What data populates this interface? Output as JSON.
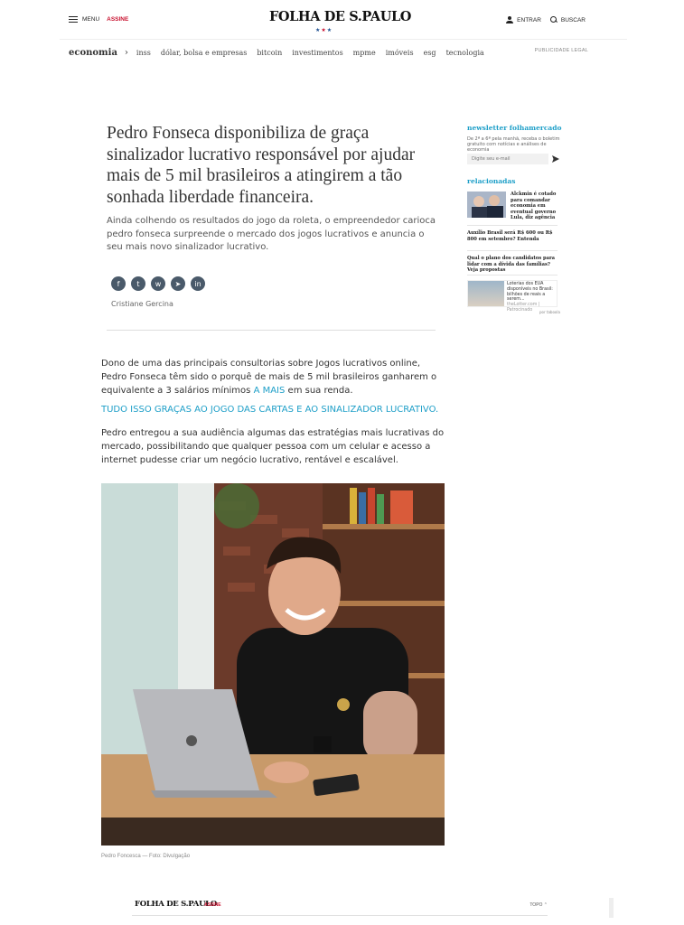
{
  "header": {
    "menu_label": "MENU",
    "subscribe_label": "ASSINE",
    "logo": "FOLHA DE S.PAULO",
    "login_label": "ENTRAR",
    "search_label": "BUSCAR"
  },
  "subnav": {
    "section": "economia",
    "items": [
      "inss",
      "dólar, bolsa e empresas",
      "bitcoin",
      "investimentos",
      "mpme",
      "imóveis",
      "esg",
      "tecnologia"
    ],
    "advertising_label": "PUBLICIDADE LEGAL"
  },
  "article": {
    "headline": "Pedro Fonseca disponibiliza de graça sinalizador lucrativo responsável por ajudar mais de 5 mil brasileiros a atingirem a tão sonhada liberdade financeira.",
    "lead": "Ainda colhendo os resultados do jogo da roleta, o empreendedor carioca pedro fonseca surpreende o mercado dos jogos lucrativos e anuncia o seu mais novo sinalizador lucrativo.",
    "author": "Cristiane Gercina",
    "paragraph1_before": "Dono de uma das principais consultorias sobre Jogos lucrativos online, Pedro Fonseca têm sido o porquê de mais de 5 mil brasileiros ganharem o equivalente a 3 salários mínimos ",
    "paragraph1_link": "A MAIS",
    "paragraph1_after": " em sua renda.",
    "highlight": "TUDO ISSO GRAÇAS AO JOGO DAS CARTAS E AO SINALIZADOR LUCRATIVO.",
    "paragraph2": "Pedro entregou a sua audiência algumas das estratégias mais lucrativas do mercado, possibilitando que qualquer pessoa com um celular e acesso a internet pudesse criar um negócio lucrativo, rentável e escalável.",
    "photo_caption": "Pedro Foncesca — Foto: Divulgação"
  },
  "sidebar": {
    "newsletter_title": "newsletter folhamercado",
    "newsletter_text": "De 2ª a 6ª pela manhã, receba o boletim gratuito com notícias e análises de economia",
    "email_placeholder": "Digite seu e-mail",
    "related_title": "relacionadas",
    "related": [
      "Alckmin é cotado para comandar economia em eventual governo Lula, diz agência",
      "Auxílio Brasil será R$ 600 ou R$ 800 em setembro? Entenda",
      "Qual o plano dos candidatos para lidar com a dívida das famílias? Veja propostas"
    ],
    "ad_text": "Loterias dos EUA disponíveis no Brasil: bilhões de reais a serem...",
    "ad_source": "theLotter.com | Patrocinado",
    "ad_by": "por taboola"
  },
  "bottombar": {
    "logo": "FOLHA DE S.PAULO",
    "subscribe_label": "ASSINE",
    "top_label": "TOPO ⌃"
  }
}
